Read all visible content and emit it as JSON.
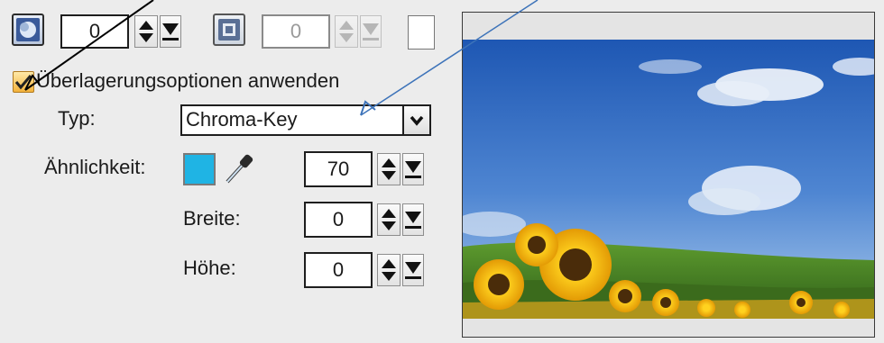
{
  "toolbar": {
    "left_value": "0",
    "right_value": "0",
    "icons": [
      "overlay-icon",
      "frame-icon",
      "color-swatch-icon"
    ]
  },
  "overlay": {
    "checkbox_label": "Überlagerungsoptionen anwenden",
    "checked": true
  },
  "type": {
    "label": "Typ:",
    "selected": "Chroma-Key"
  },
  "similarity": {
    "label": "Ähnlichkeit:",
    "value": "70",
    "key_color": "#1fb4e4"
  },
  "width": {
    "label": "Breite:",
    "value": "0"
  },
  "height": {
    "label": "Höhe:",
    "value": "0"
  },
  "colors": {
    "background": "#ececec",
    "annotation_arrow_black": "#000000",
    "annotation_arrow_blue": "#3d73b9"
  }
}
